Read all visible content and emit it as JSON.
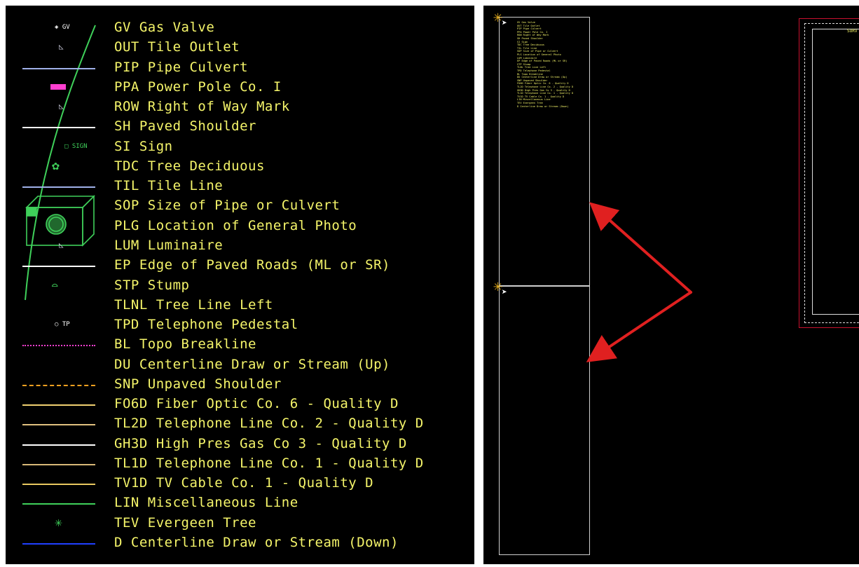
{
  "legend": {
    "items": [
      {
        "label": "GV Gas Valve",
        "symbol": "gas-valve-symbol",
        "symbol_text": "◈ GV"
      },
      {
        "label": "OUT Tile Outlet",
        "symbol": "tile-outlet-symbol"
      },
      {
        "label": "PIP Pipe Culvert",
        "symbol": "pipe-culvert-line",
        "color": "#9fb0e8"
      },
      {
        "label": "PPA Power Pole Co. I",
        "symbol": "power-pole-symbol",
        "color": "#ff3fd0"
      },
      {
        "label": "ROW Right of Way Mark",
        "symbol": "row-mark-symbol"
      },
      {
        "label": "SH Paved Shoulder",
        "symbol": "paved-shoulder-line",
        "color": "#ffffff"
      },
      {
        "label": "SI Sign",
        "symbol": "sign-symbol",
        "symbol_text": "□ SIGN"
      },
      {
        "label": "TDC Tree Deciduous",
        "symbol": "deciduous-tree-symbol"
      },
      {
        "label": "TIL Tile Line",
        "symbol": "tile-line",
        "color": "#9fb0e8"
      },
      {
        "label": "SOP Size of Pipe or Culvert",
        "symbol": "none"
      },
      {
        "label": "PLG Location of General Photo",
        "symbol": "camera-symbol"
      },
      {
        "label": "LUM Luminaire",
        "symbol": "luminaire-symbol"
      },
      {
        "label": "EP Edge of Paved Roads (ML or SR)",
        "symbol": "edge-paved-line",
        "color": "#ffffff"
      },
      {
        "label": "STP Stump",
        "symbol": "stump-symbol"
      },
      {
        "label": "TLNL Tree Line Left",
        "symbol": "none"
      },
      {
        "label": "TPD Telephone Pedestal",
        "symbol": "telephone-pedestal-symbol",
        "symbol_text": "○ TP"
      },
      {
        "label": "BL Topo Breakline",
        "symbol": "breakline-line",
        "color": "#ff3fd0"
      },
      {
        "label": "DU Centerline Draw or Stream (Up)",
        "symbol": "none"
      },
      {
        "label": "SNP Unpaved Shoulder",
        "symbol": "unpaved-shoulder-line",
        "color": "#f0a020"
      },
      {
        "label": "FO6D Fiber Optic Co. 6 - Quality D",
        "symbol": "fiber-optic-line",
        "color": "#f0d070"
      },
      {
        "label": "TL2D Telephone Line Co. 2 - Quality D",
        "symbol": "telephone-line-2",
        "color": "#e0c080"
      },
      {
        "label": "GH3D High Pres Gas Co 3 - Quality D",
        "symbol": "gas-line",
        "color": "#ffffff"
      },
      {
        "label": "TL1D Telephone Line Co. 1 - Quality D",
        "symbol": "telephone-line-1",
        "color": "#d8b878"
      },
      {
        "label": "TV1D TV Cable Co. 1 - Quality D",
        "symbol": "tv-cable-line",
        "color": "#e8c860"
      },
      {
        "label": "LIN Miscellaneous Line",
        "symbol": "misc-line",
        "color": "#3fd05a"
      },
      {
        "label": "TEV Evergeen Tree",
        "symbol": "evergreen-tree-symbol",
        "symbol_text": "✳"
      },
      {
        "label": "D Centerline Draw or Stream (Down)",
        "symbol": "stream-down-line",
        "color": "#2040ff"
      }
    ]
  },
  "canvas": {
    "title_fragment": "SURV",
    "arrow_color": "#e02020",
    "mini_legend_lines": [
      "GV Gas Valve",
      "OUT Tile Outlet",
      "PIP Pipe Culvert",
      "PPA Power Pole Co. I",
      "ROW Right of Way Mark",
      "SH Paved Shoulder",
      "SI Sign",
      "TDC Tree Deciduous",
      "TIL Tile Line",
      "SOP Size of Pipe or Culvert",
      "PLG Location of General Photo",
      "LUM Luminaire",
      "EP Edge of Paved Roads (ML or SR)",
      "STP Stump",
      "TLNL Tree Line Left",
      "TPD Telephone Pedestal",
      "BL Topo Breakline",
      "DU Centerline Draw or Stream (Up)",
      "SNP Unpaved Shoulder",
      "FO6D Fiber Optic Co. 6 - Quality D",
      "TL2D Telephone Line Co. 2 - Quality D",
      "GH3D High Pres Gas Co 3 - Quality D",
      "TL1D Telephone Line Co. 1 - Quality D",
      "TV1D TV Cable Co. 1 - Quality D",
      "LIN Miscellaneous Line",
      "TEV Evergeen Tree",
      "D Centerline Draw or Stream (Down)"
    ]
  },
  "colors": {
    "background": "#000000",
    "label_yellow": "#f5f56a",
    "green": "#3fd05a",
    "frame_red": "#c8102e"
  }
}
